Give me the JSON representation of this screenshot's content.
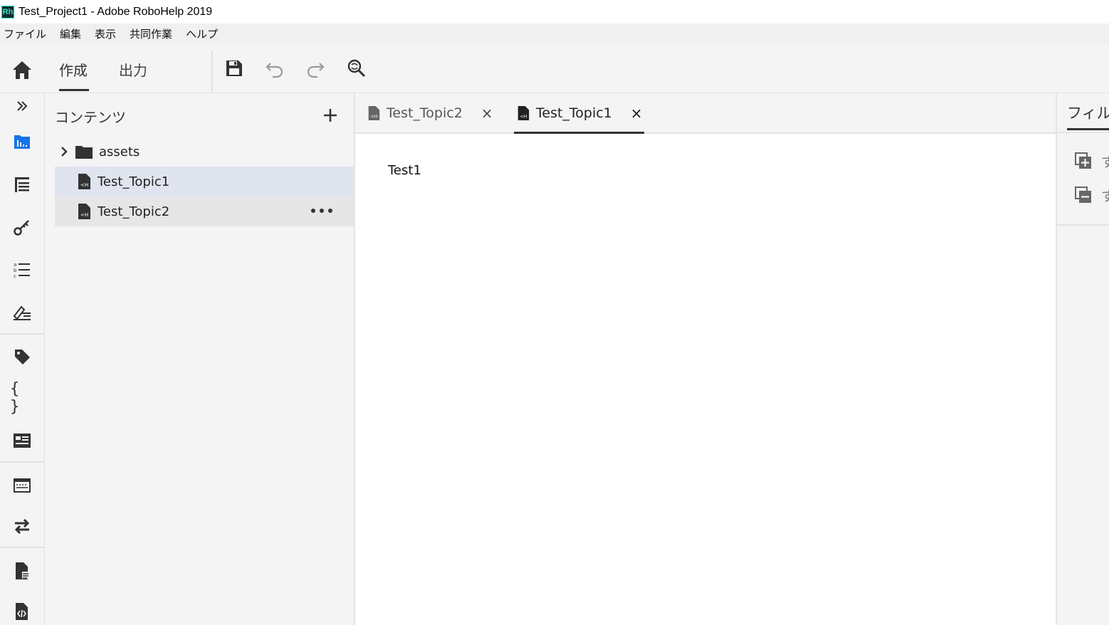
{
  "window": {
    "app_icon_text": "Rh",
    "title": "Test_Project1 - Adobe RoboHelp 2019"
  },
  "menubar": {
    "items": [
      "ファイル",
      "編集",
      "表示",
      "共同作業",
      "ヘルプ"
    ]
  },
  "toolbar": {
    "home_icon": "home-icon",
    "modes": [
      {
        "label": "作成",
        "active": true
      },
      {
        "label": "出力",
        "active": false
      }
    ],
    "actions": [
      "save-icon",
      "undo-icon",
      "redo-icon",
      "find-replace-icon"
    ]
  },
  "rail": {
    "items": [
      "expand-icon",
      "contents-icon",
      "toc-icon",
      "key-icon",
      "list-icon",
      "glossary-icon",
      "tag-icon",
      "variables-icon",
      "snippets-icon",
      "browse-sequence-icon",
      "redirects-icon",
      "reports-icon",
      "scripts-icon"
    ]
  },
  "contents_panel": {
    "title": "コンテンツ",
    "add_icon": "plus-icon",
    "tree": [
      {
        "label": "assets",
        "type": "folder",
        "state": "collapsed"
      },
      {
        "label": "Test_Topic1",
        "type": "topic",
        "state": "selected"
      },
      {
        "label": "Test_Topic2",
        "type": "topic",
        "state": "hover"
      }
    ]
  },
  "editor": {
    "tabs": [
      {
        "label": "Test_Topic2",
        "active": false
      },
      {
        "label": "Test_Topic1",
        "active": true
      }
    ],
    "close_glyph": "×",
    "body_text": "Test1"
  },
  "right_panel": {
    "title": "フィルター",
    "rows": [
      {
        "icon": "expand-all-icon",
        "label": "す"
      },
      {
        "icon": "collapse-all-icon",
        "label": "す"
      }
    ]
  },
  "colors": {
    "panel_bg": "#f4f4f4",
    "selected_row": "#dfe4ee",
    "hover_row": "#e6e6e6",
    "accent": "#1473e6",
    "icon": "#333333"
  }
}
